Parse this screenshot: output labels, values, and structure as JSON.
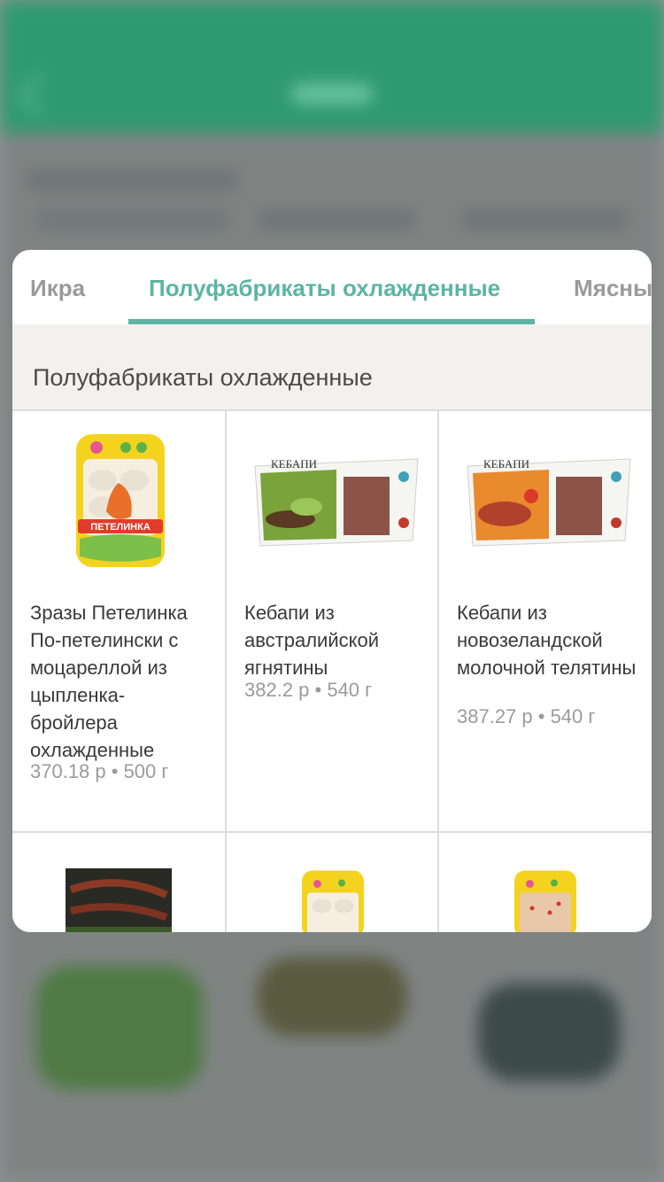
{
  "tabs": [
    {
      "label": "Икра",
      "active": false
    },
    {
      "label": "Полуфабрикаты охлажденные",
      "active": true
    },
    {
      "label": "Мясны",
      "active": false
    }
  ],
  "section_title": "Полуфабрикаты охлажденные",
  "products": [
    {
      "name": "Зразы Петелинка По-петелински с моцареллой из цыпленка-бройлера охлажденные",
      "meta": "370.18 р • 500 г",
      "image": "petelinka-pack",
      "image_label": "ПЕТЕЛИНКА"
    },
    {
      "name": "Кебапи из австралийской ягнятины",
      "meta": "382.2 р • 540 г",
      "image": "kebapi-green-box",
      "image_label": "КЕБАПИ"
    },
    {
      "name": "Кебапи из новозеландской молочной телятины",
      "meta": "387.27 р • 540 г",
      "image": "kebapi-orange-box",
      "image_label": "КЕБАПИ"
    },
    {
      "name": "",
      "meta": "",
      "image": "sausage-pack",
      "image_label": ""
    },
    {
      "name": "",
      "meta": "",
      "image": "petelinka-pack-2",
      "image_label": ""
    },
    {
      "name": "",
      "meta": "",
      "image": "petelinka-pack-3",
      "image_label": ""
    }
  ],
  "colors": {
    "accent": "#5cb5a2",
    "header": "#2f9a72",
    "tab_inactive": "#9a9a9a"
  }
}
